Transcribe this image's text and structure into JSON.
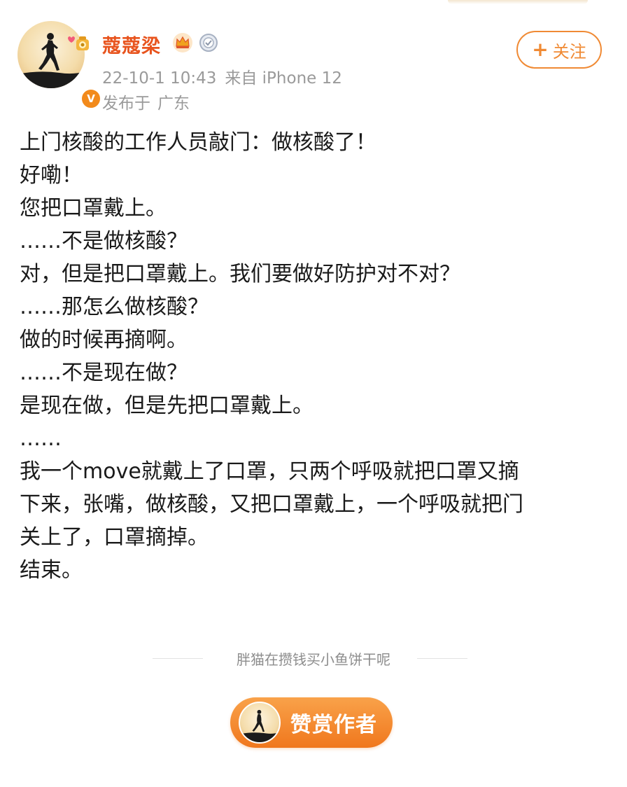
{
  "header": {
    "username": "蔻蔻梁",
    "timestamp": "22-10-1 10:43",
    "source": "来自 iPhone 12",
    "location_prefix": "发布于",
    "location": "广东",
    "follow_label": "关注",
    "verified_badge": "V",
    "icons": {
      "avatar": "avatar-runner-silhouette",
      "crown": "crown-icon",
      "medal": "medal-icon",
      "verified": "verified-badge-icon"
    }
  },
  "post": {
    "lines": [
      "上门核酸的工作人员敲门：做核酸了！",
      "好嘞！",
      "您把口罩戴上。",
      "……不是做核酸？",
      "对，但是把口罩戴上。我们要做好防护对不对？",
      "……那怎么做核酸？",
      "做的时候再摘啊。",
      "……不是现在做？",
      "是现在做，但是先把口罩戴上。",
      "……",
      "我一个move就戴上了口罩，只两个呼吸就把口罩又摘",
      "下来，张嘴，做核酸，又把口罩戴上，一个呼吸就把门",
      "关上了，口罩摘掉。",
      "结束。"
    ]
  },
  "footer": {
    "reward_caption": "胖猫在攒钱买小鱼饼干呢",
    "reward_button_label": "赞赏作者"
  },
  "colors": {
    "username": "#e8541e",
    "follow_border": "#f08a34",
    "meta_gray": "#9a9a9a",
    "reward_button": "#f48a2c"
  }
}
